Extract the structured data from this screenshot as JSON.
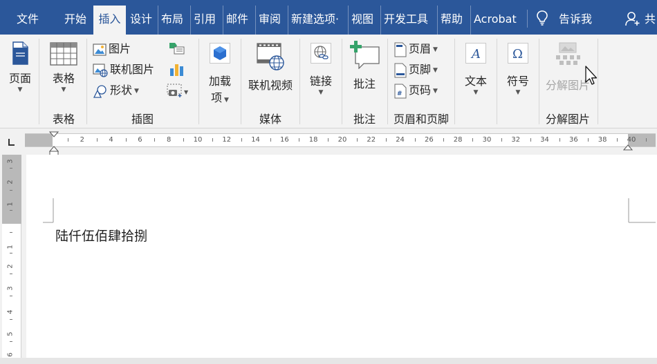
{
  "menu": {
    "tabs": [
      {
        "label": "文件"
      },
      {
        "label": "开始"
      },
      {
        "label": "插入"
      },
      {
        "label": "设计"
      },
      {
        "label": "布局"
      },
      {
        "label": "引用"
      },
      {
        "label": "邮件"
      },
      {
        "label": "审阅"
      },
      {
        "label": "新建选项·"
      },
      {
        "label": "视图"
      },
      {
        "label": "开发工具"
      },
      {
        "label": "帮助"
      },
      {
        "label": "Acrobat"
      }
    ],
    "tell_me": "告诉我",
    "share": "共",
    "active_tab": "插入"
  },
  "ribbon": {
    "pages": {
      "label": "页面"
    },
    "table": {
      "button": "表格",
      "group": "表格"
    },
    "illustrations": {
      "group": "插图",
      "picture": "图片",
      "online_picture": "联机图片",
      "shapes": "形状"
    },
    "addins": {
      "label_1": "加载",
      "label_2": "项"
    },
    "media": {
      "button": "联机视频",
      "group": "媒体"
    },
    "links": {
      "label": "链接"
    },
    "comments": {
      "button": "批注",
      "group": "批注"
    },
    "header_footer": {
      "group": "页眉和页脚",
      "header": "页眉",
      "footer": "页脚",
      "page_number": "页码"
    },
    "text": {
      "label": "文本"
    },
    "symbols": {
      "label": "符号"
    },
    "split_picture": {
      "button": "分解图片",
      "group": "分解图片"
    }
  },
  "ruler": {
    "ticks": [
      "2",
      "4",
      "6",
      "8",
      "10",
      "12",
      "14",
      "16",
      "18",
      "20",
      "22",
      "24",
      "26",
      "28",
      "30",
      "32",
      "34",
      "36",
      "38",
      "40"
    ],
    "vticks": [
      "3",
      "2",
      "1",
      "1",
      "2",
      "3",
      "4",
      "5",
      "6"
    ]
  },
  "document": {
    "text": "陆仟伍佰肆拾捌"
  },
  "colors": {
    "accent": "#2b579a",
    "ribbon_bg": "#f3f3f3",
    "disabled": "#a6a6a6"
  }
}
